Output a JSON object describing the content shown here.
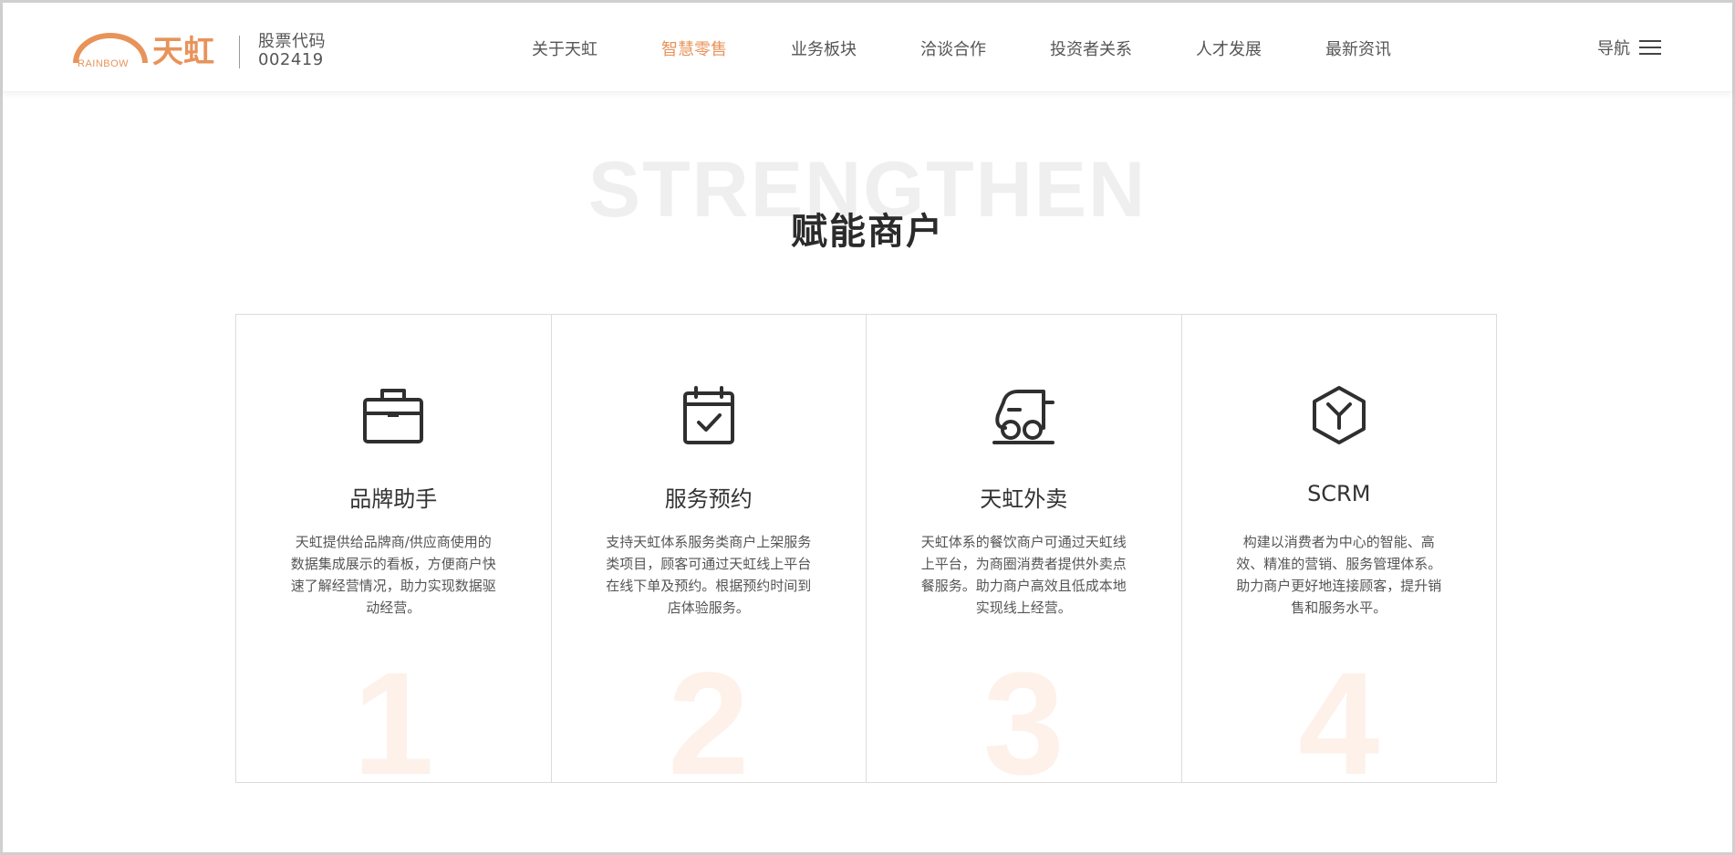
{
  "header": {
    "logo": {
      "mark_text": "RAINBOW",
      "chinese_name": "天虹"
    },
    "stock_label": "股票代码",
    "stock_code": "002419",
    "nav": [
      {
        "label": "关于天虹",
        "active": false
      },
      {
        "label": "智慧零售",
        "active": true
      },
      {
        "label": "业务板块",
        "active": false
      },
      {
        "label": "洽谈合作",
        "active": false
      },
      {
        "label": "投资者关系",
        "active": false
      },
      {
        "label": "人才发展",
        "active": false
      },
      {
        "label": "最新资讯",
        "active": false
      }
    ],
    "menu_label": "导航"
  },
  "section": {
    "background_word": "STRENGTHEN",
    "title": "赋能商户"
  },
  "cards": [
    {
      "icon": "briefcase-icon",
      "title": "品牌助手",
      "description": "天虹提供给品牌商/供应商使用的数据集成展示的看板，方便商户快速了解经营情况，助力实现数据驱动经营。",
      "number": "1"
    },
    {
      "icon": "calendar-check-icon",
      "title": "服务预约",
      "description": "支持天虹体系服务类商户上架服务类项目，顾客可通过天虹线上平台在线下单及预约。根据预约时间到店体验服务。",
      "number": "2"
    },
    {
      "icon": "delivery-scooter-icon",
      "title": "天虹外卖",
      "description": "天虹体系的餐饮商户可通过天虹线上平台，为商圈消费者提供外卖点餐服务。助力商户高效且低成本地实现线上经营。",
      "number": "3"
    },
    {
      "icon": "cube-icon",
      "title": "SCRM",
      "description": "构建以消费者为中心的智能、高效、精准的营销、服务管理体系。助力商户更好地连接顾客，提升销售和服务水平。",
      "number": "4"
    }
  ],
  "colors": {
    "accent": "#e8935a",
    "text": "#333333",
    "background_word": "#efefef",
    "card_number": "#fdf1ea",
    "border": "#dcdcdc"
  }
}
